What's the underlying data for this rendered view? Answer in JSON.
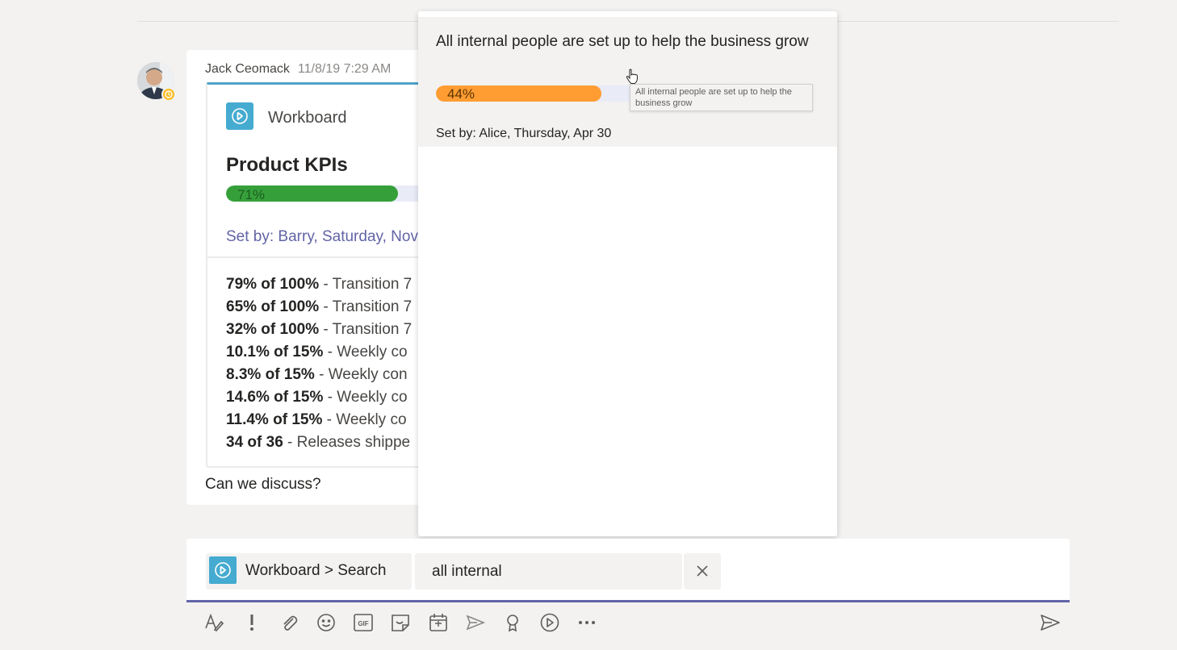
{
  "message": {
    "author": "Jack Ceomack",
    "timestamp": "11/8/19 7:29 AM",
    "card": {
      "app_name": "Workboard",
      "title": "Product KPIs",
      "progress_percent": 71,
      "progress_label": "71%",
      "set_by": "Set by: Barry, Saturday, Nov",
      "kpis": [
        {
          "value": "79% of 100%",
          "desc": " - Transition 7"
        },
        {
          "value": "65% of 100%",
          "desc": " - Transition 7"
        },
        {
          "value": "32% of 100%",
          "desc": " - Transition 7"
        },
        {
          "value": "10.1% of 15%",
          "desc": " - Weekly co"
        },
        {
          "value": "8.3% of 15%",
          "desc": " - Weekly con"
        },
        {
          "value": "14.6% of 15%",
          "desc": " - Weekly co"
        },
        {
          "value": "11.4% of 15%",
          "desc": " - Weekly co"
        },
        {
          "value": "34 of 36",
          "desc": " - Releases shippe"
        }
      ],
      "colors": {
        "accent": "#4fa3c7",
        "progress": "#35a03a",
        "link": "#6264a7"
      }
    },
    "footer_text": "Can we discuss?"
  },
  "popup": {
    "result": {
      "title": "All internal people are set up to help the business grow",
      "progress_percent": 44,
      "progress_label": "44%",
      "set_by": "Set by: Alice, Thursday, Apr 30",
      "tooltip": "All internal people are set up to help the business grow",
      "colors": {
        "progress": "#ff9d33",
        "track": "#e9ebf7"
      }
    }
  },
  "compose": {
    "breadcrumb": "Workboard > Search",
    "search_value": "all internal",
    "accent_color": "#6264a7"
  },
  "toolbar": {
    "icons": [
      "format-icon",
      "important-icon",
      "attach-icon",
      "emoji-icon",
      "gif-icon",
      "sticker-icon",
      "meeting-icon",
      "stream-icon",
      "praise-icon",
      "workboard-icon",
      "more-icon"
    ],
    "send_icon": "send-icon"
  }
}
